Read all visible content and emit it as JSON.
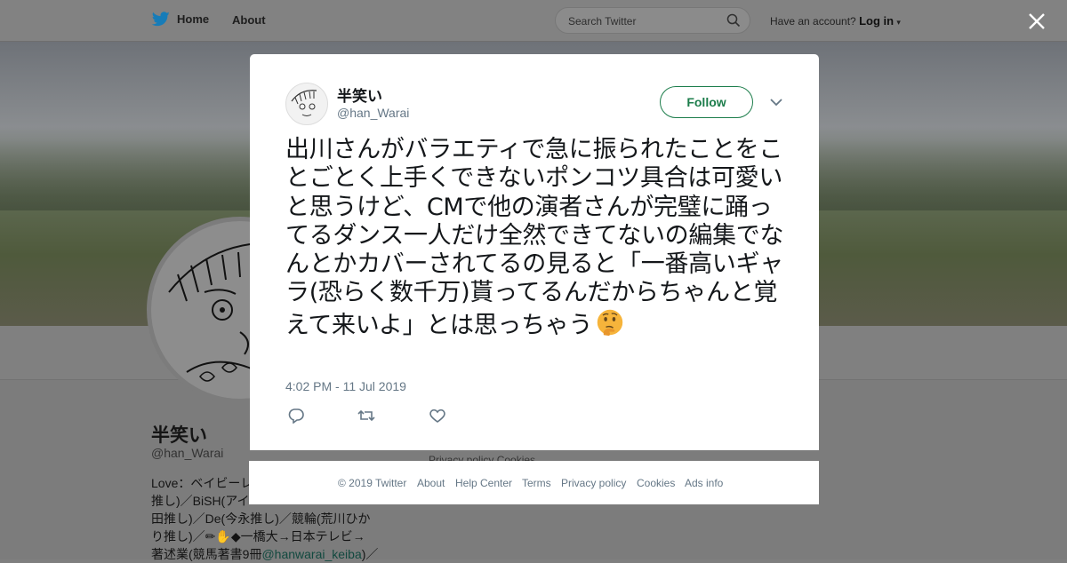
{
  "nav": {
    "home_label": "Home",
    "about_label": "About",
    "search_placeholder": "Search Twitter",
    "account_prompt": "Have an account?",
    "login_label": "Log in"
  },
  "background_profile": {
    "name": "半笑い",
    "handle": "@han_Warai",
    "bio_lines": [
      "Love：ベイビーレ",
      "推し)／BiSH(アイ",
      "田推し)／De(今永推し)／競輪(荒川ひか",
      "り推し)／",
      "◆一橋大→日本テレビ→",
      "著述業(競馬著書9冊"
    ],
    "bio_link": "@hanwarai_keiba",
    "bio_tail": ")／",
    "privacy_text": "Privacy policy   Cookies"
  },
  "tweet": {
    "author_name": "半笑い",
    "author_handle": "@han_Warai",
    "follow_label": "Follow",
    "text": "出川さんがバラエティで急に振られたことをことごとく上手くできないポンコツ具合は可愛いと思うけど、CMで他の演者さんが完璧に踊ってるダンス一人だけ全然できてないの編集でなんとかカバーされてるの見ると「一番高いギャラ(恐らく数千万)貰ってるんだからちゃんと覚えて来いよ」とは思っちゃう",
    "emoji": "thinking-face",
    "timestamp": "4:02 PM - 11 Jul 2019"
  },
  "footer": {
    "copyright": "© 2019 Twitter",
    "about": "About",
    "help": "Help Center",
    "terms": "Terms",
    "privacy": "Privacy policy",
    "cookies": "Cookies",
    "ads": "Ads info"
  },
  "colors": {
    "follow_green": "#1c7d4b",
    "muted_text": "#657786",
    "twitter_blue": "#1da1f2"
  }
}
